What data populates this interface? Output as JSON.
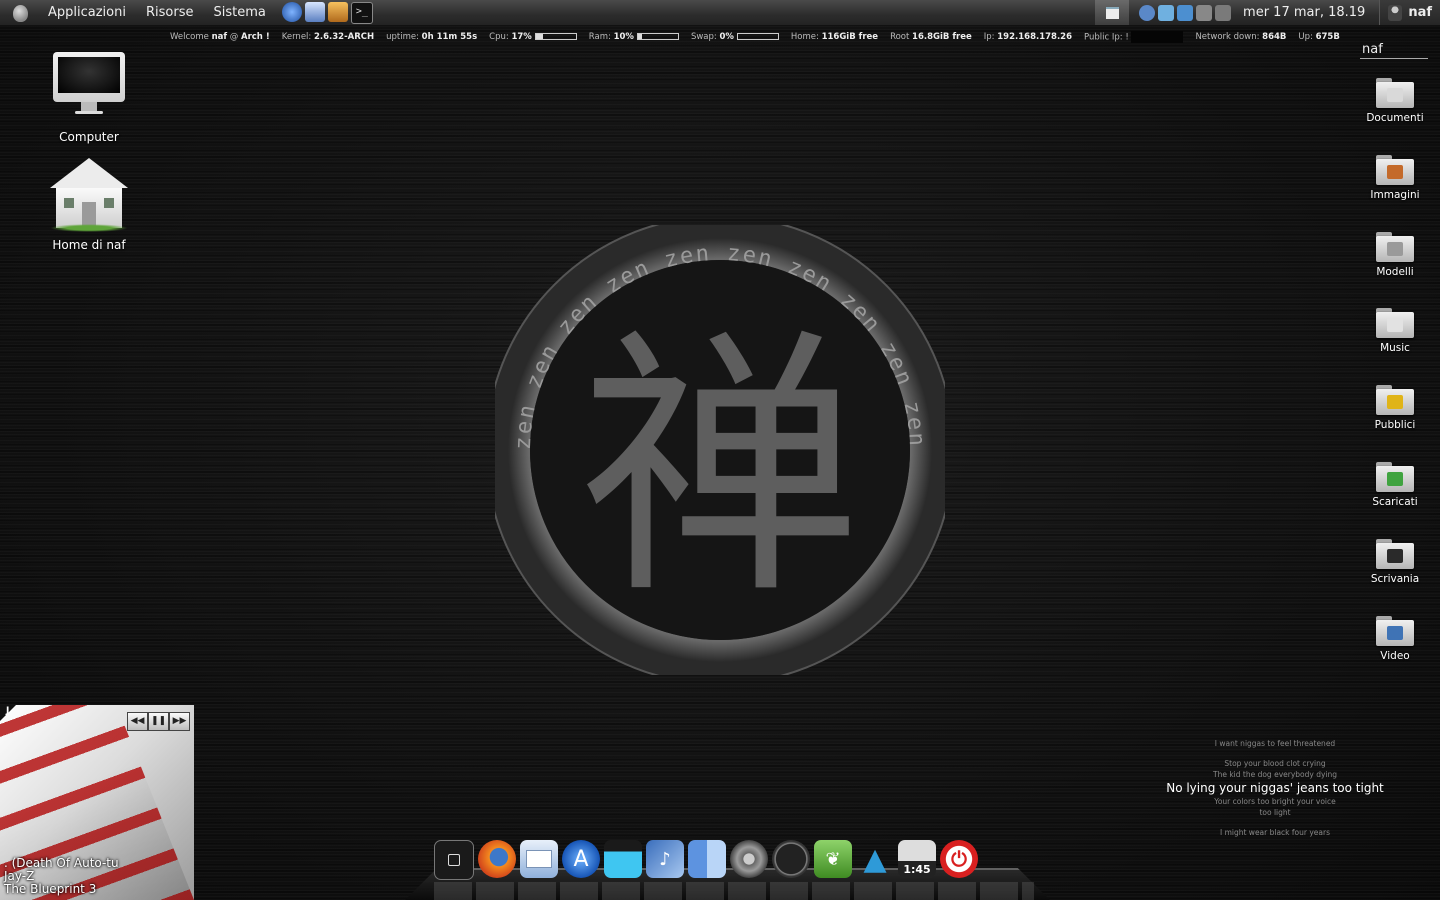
{
  "top_panel": {
    "menus": [
      "Applicazioni",
      "Risorse",
      "Sistema"
    ],
    "clock": "mer 17 mar, 18.19",
    "user": "naf",
    "launchers": [
      "web-browser-icon",
      "mail-icon",
      "gimp-icon",
      "terminal-icon"
    ]
  },
  "conky": {
    "welcome_label": "Welcome",
    "user": "naf",
    "at": "@",
    "host": "Arch !",
    "kernel_label": "Kernel:",
    "kernel": "2.6.32-ARCH",
    "uptime_label": "uptime:",
    "uptime": "0h 11m 55s",
    "cpu_label": "Cpu:",
    "cpu": "17%",
    "cpu_fraction": 0.17,
    "ram_label": "Ram:",
    "ram": "10%",
    "ram_fraction": 0.1,
    "swap_label": "Swap:",
    "swap": "0%",
    "swap_fraction": 0.0,
    "home_label": "Home:",
    "home": "116GiB free",
    "root_label": "Root",
    "root": "16.8GiB free",
    "ip_label": "Ip:",
    "ip": "192.168.178.26",
    "public_ip_label": "Public Ip: !",
    "net_down_label": "Network down:",
    "net_down": "864B",
    "net_up_label": "Up:",
    "net_up": "675B"
  },
  "desktop_icons": [
    {
      "label": "Computer"
    },
    {
      "label": "Home di naf"
    }
  ],
  "search_value": "naf",
  "folders": [
    {
      "label": "Documenti",
      "emblem_color": "#d9d9d9"
    },
    {
      "label": "Immagini",
      "emblem_color": "#c46a2a"
    },
    {
      "label": "Modelli",
      "emblem_color": "#9a9a9a"
    },
    {
      "label": "Music",
      "emblem_color": "#e2e2e2"
    },
    {
      "label": "Pubblici",
      "emblem_color": "#e0b418"
    },
    {
      "label": "Scaricati",
      "emblem_color": "#3fa33f"
    },
    {
      "label": "Scrivania",
      "emblem_color": "#2a2a2a"
    },
    {
      "label": "Video",
      "emblem_color": "#3f73b5"
    }
  ],
  "logo": {
    "kanji": "禅",
    "ring_text": "zen"
  },
  "lyrics": {
    "line1": "I want niggas to feel threatened",
    "line2": "Stop your blood clot crying",
    "line3": "The kid the dog everybody dying",
    "current": "No lying your niggas' jeans too tight",
    "line5": "Your colors too bright your voice",
    "line6": "too light",
    "line7": "I might wear black four years"
  },
  "music_widget": {
    "corner_letter": "J",
    "title": ". (Death Of Auto-tu",
    "artist": "Jay-Z",
    "album": "The Blueprint 3",
    "controls": {
      "prev": "◀◀",
      "pause": "❚❚",
      "next": "▶▶"
    }
  },
  "dock": {
    "items": [
      "quicksilver-icon",
      "firefox-icon",
      "mail-icon",
      "app-store-icon",
      "video-editor-icon",
      "itunes-icon",
      "finder-icon",
      "system-preferences-icon",
      "clock-icon",
      "leaf-icon",
      "arch-icon",
      "calendar-icon",
      "power-icon"
    ],
    "calendar_time": "1:45"
  },
  "colors": {
    "accent": "#d92020",
    "panel": "#2c2c2c",
    "background": "#121212"
  }
}
